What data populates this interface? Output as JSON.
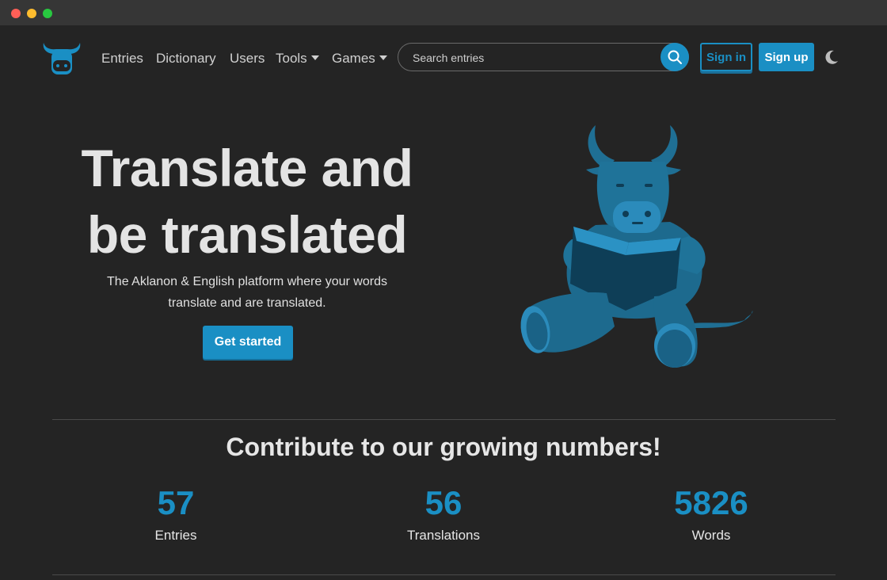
{
  "window": {
    "controls": [
      "close",
      "minimize",
      "maximize"
    ]
  },
  "nav": {
    "logo_icon": "bull-head-icon",
    "links": [
      {
        "label": "Entries"
      },
      {
        "label": "Dictionary"
      },
      {
        "label": "Users"
      },
      {
        "label": "Tools",
        "dropdown": true
      },
      {
        "label": "Games",
        "dropdown": true
      }
    ],
    "search": {
      "placeholder": "Search entries",
      "value": "",
      "icon": "search-icon"
    },
    "sign_in_label": "Sign in",
    "sign_up_label": "Sign up",
    "theme_icon": "moon-icon"
  },
  "hero": {
    "title": "Translate and be translated",
    "subtitle": "The Aklanon & English platform where your words translate and are translated.",
    "cta_label": "Get started",
    "illustration": "bull-reading-book-illustration"
  },
  "stats": {
    "title": "Contribute to our growing numbers!",
    "items": [
      {
        "value": "57",
        "label": "Entries"
      },
      {
        "value": "56",
        "label": "Translations"
      },
      {
        "value": "5826",
        "label": "Words"
      }
    ]
  },
  "colors": {
    "accent": "#1a8fc4",
    "background": "#242424",
    "titlebar": "#363636"
  }
}
